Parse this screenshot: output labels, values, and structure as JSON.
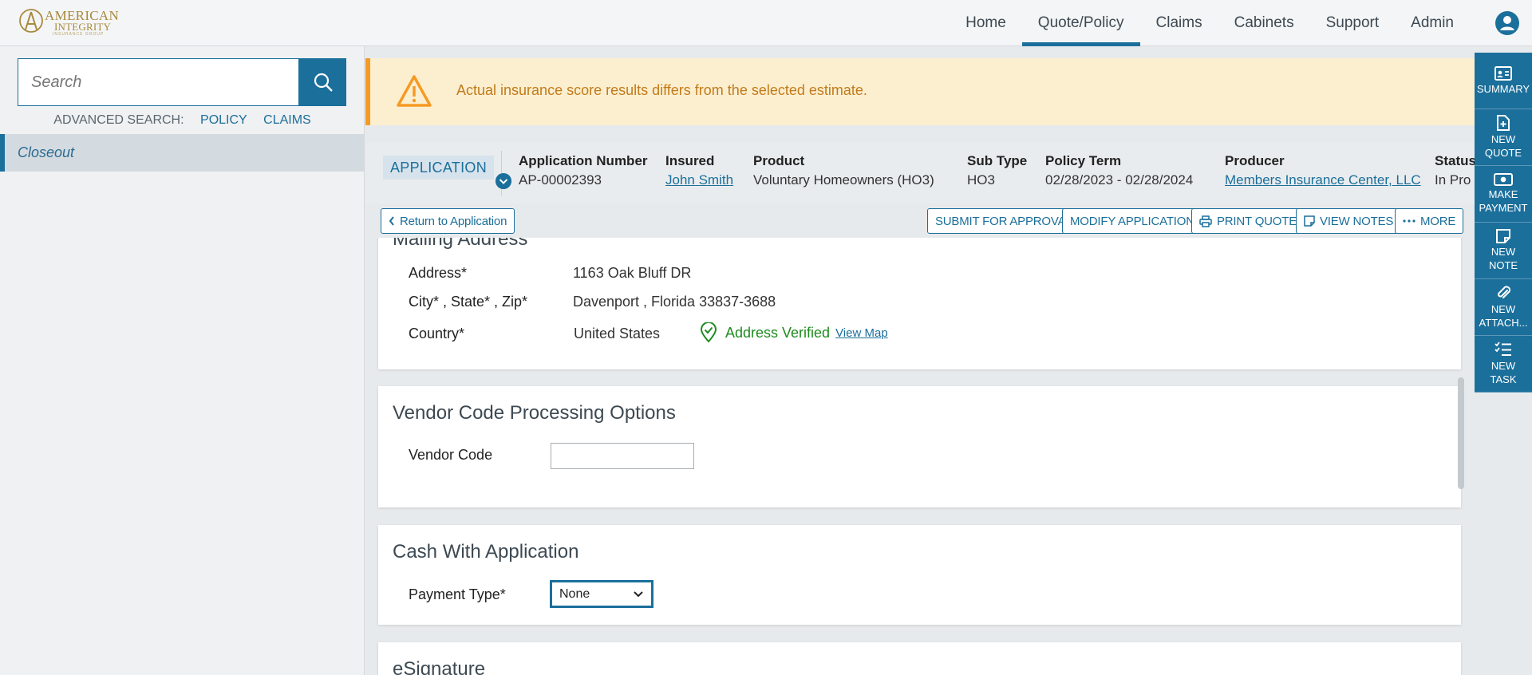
{
  "brand": {
    "line1": "AMERICAN",
    "line2": "INTEGRITY",
    "line3": "INSURANCE GROUP"
  },
  "nav": {
    "items": [
      "Home",
      "Quote/Policy",
      "Claims",
      "Cabinets",
      "Support",
      "Admin"
    ],
    "active": "Quote/Policy"
  },
  "sidebar": {
    "search_placeholder": "Search",
    "advanced_label": "ADVANCED SEARCH:",
    "advanced_policy": "POLICY",
    "advanced_claims": "CLAIMS",
    "selected_item": "Closeout"
  },
  "alert": {
    "message": "Actual insurance score results differs from the selected estimate."
  },
  "application": {
    "badge": "APPLICATION",
    "number_label": "Application Number",
    "number": "AP-00002393",
    "insured_label": "Insured",
    "insured": "John Smith",
    "product_label": "Product",
    "product": "Voluntary Homeowners (HO3)",
    "subtype_label": "Sub Type",
    "subtype": "HO3",
    "term_label": "Policy Term",
    "term": "02/28/2023 - 02/28/2024",
    "producer_label": "Producer",
    "producer": "Members Insurance Center, LLC",
    "status_label": "Status",
    "status": "In Pro"
  },
  "toolbar": {
    "return": "Return to Application",
    "submit": "SUBMIT FOR APPROVAL",
    "modify": "MODIFY APPLICATION",
    "print": "PRINT QUOTE",
    "notes": "VIEW NOTES",
    "more": "MORE"
  },
  "mailing": {
    "title": "Mailing Address",
    "address_label": "Address*",
    "address": "1163 Oak Bluff DR",
    "csz_label": "City* , State* , Zip*",
    "csz": "Davenport , Florida 33837-3688",
    "country_label": "Country*",
    "country": "United States",
    "verified": "Address Verified",
    "view_map": "View Map"
  },
  "vendor": {
    "title": "Vendor Code Processing Options",
    "label": "Vendor Code",
    "value": ""
  },
  "cash": {
    "title": "Cash With Application",
    "label": "Payment Type*",
    "selected": "None"
  },
  "esign": {
    "title": "eSignature"
  },
  "rail": [
    {
      "icon": "summary-icon",
      "label1": "SUMMARY",
      "label2": ""
    },
    {
      "icon": "new-quote-icon",
      "label1": "NEW",
      "label2": "QUOTE"
    },
    {
      "icon": "make-payment-icon",
      "label1": "MAKE",
      "label2": "PAYMENT"
    },
    {
      "icon": "new-note-icon",
      "label1": "NEW",
      "label2": "NOTE"
    },
    {
      "icon": "new-attachment-icon",
      "label1": "NEW",
      "label2": "ATTACH..."
    },
    {
      "icon": "new-task-icon",
      "label1": "NEW",
      "label2": "TASK"
    }
  ],
  "colors": {
    "primary": "#1b6f9b",
    "alert_bg": "#fcefcf",
    "alert_accent": "#f59a23",
    "verified": "#1e8c1e",
    "brand_gold": "#a88a3d"
  }
}
